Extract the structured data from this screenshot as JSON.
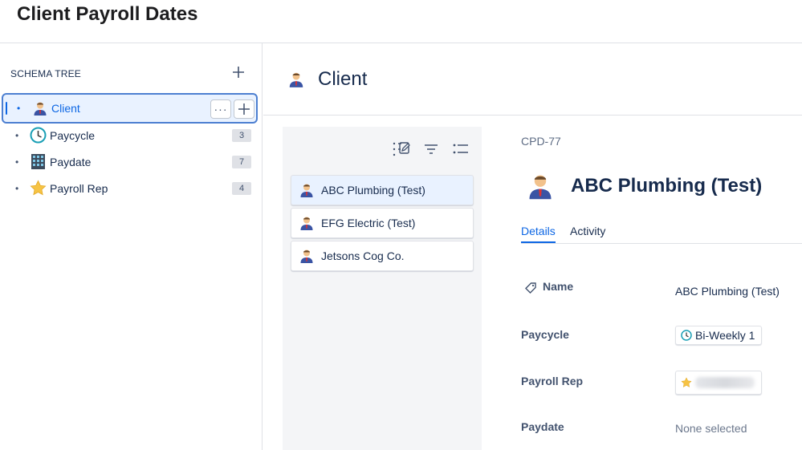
{
  "page": {
    "title": "Client Payroll Dates"
  },
  "sidebar": {
    "heading": "SCHEMA TREE",
    "items": [
      {
        "label": "Client",
        "icon": "person-icon",
        "count": ""
      },
      {
        "label": "Paycycle",
        "icon": "clock-icon",
        "count": "3"
      },
      {
        "label": "Paydate",
        "icon": "calendar-grid-icon",
        "count": "7"
      },
      {
        "label": "Payroll Rep",
        "icon": "star-icon",
        "count": "4"
      }
    ],
    "more_label": "···"
  },
  "main": {
    "title": "Client",
    "icon": "person-icon"
  },
  "list": {
    "tools": [
      "edit-list-icon",
      "filter-icon",
      "list-view-icon"
    ],
    "items": [
      {
        "label": "ABC Plumbing (Test)"
      },
      {
        "label": "EFG Electric (Test)"
      },
      {
        "label": "Jetsons Cog Co."
      }
    ]
  },
  "detail": {
    "key": "CPD-77",
    "title": "ABC Plumbing (Test)",
    "tabs": [
      "Details",
      "Activity"
    ],
    "fields": {
      "name_label": "Name",
      "name_value": "ABC Plumbing (Test)",
      "paycycle_label": "Paycycle",
      "paycycle_value": "Bi-Weekly 1",
      "payrollrep_label": "Payroll Rep",
      "paydate_label": "Paydate",
      "paydate_value": "None selected"
    }
  },
  "colors": {
    "accent": "#0c66e4",
    "selected_bg": "#e9f2ff",
    "panel_bg": "#f4f5f7"
  }
}
